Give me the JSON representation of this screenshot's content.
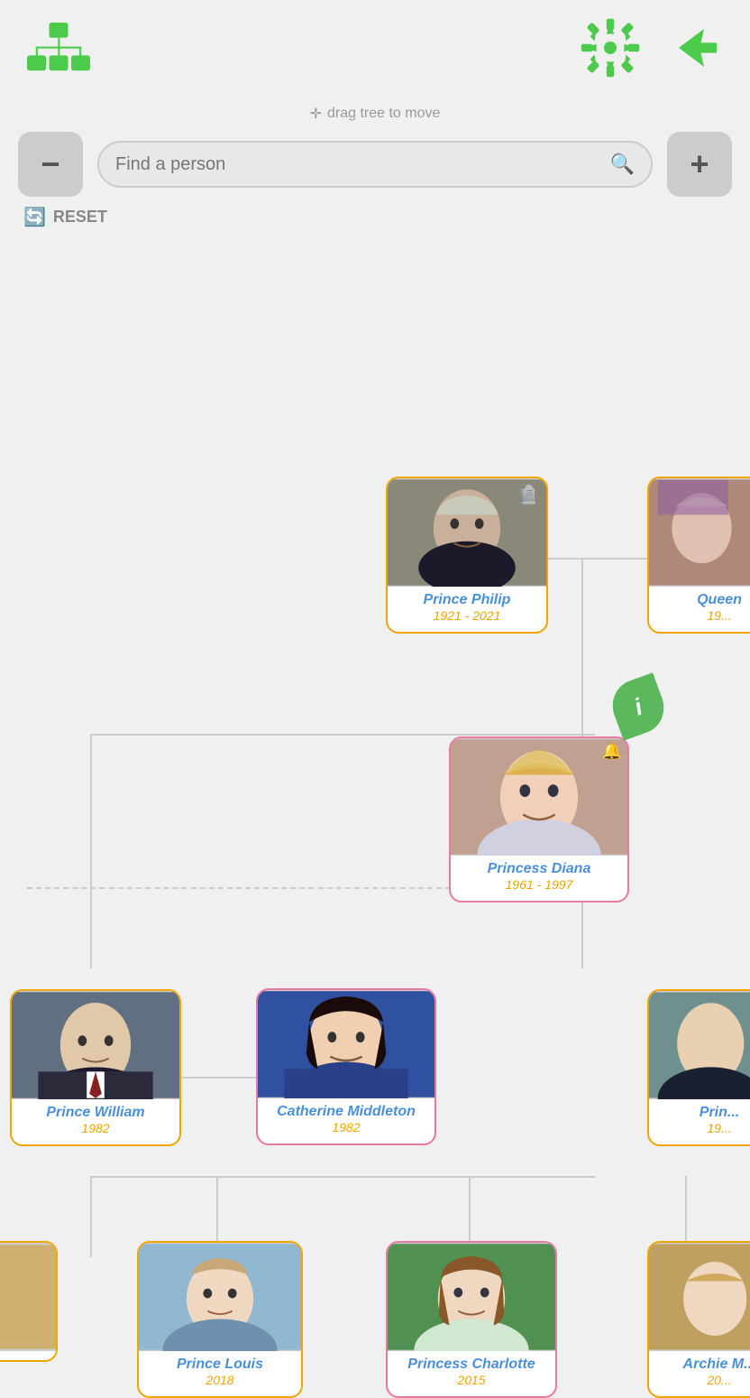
{
  "header": {
    "org_icon_label": "org-chart",
    "gear_icon_label": "settings",
    "share_icon_label": "share"
  },
  "toolbar": {
    "drag_hint": "drag tree to move",
    "search_placeholder": "Find a person",
    "zoom_out_label": "−",
    "zoom_in_label": "+",
    "reset_label": "RESET"
  },
  "persons": {
    "prince_philip": {
      "name": "Prince Philip",
      "years": "1921 - 2021",
      "deceased": true
    },
    "queen": {
      "name": "Queen",
      "years": "19...",
      "deceased": false
    },
    "princess_diana": {
      "name": "Princess Diana",
      "years": "1961 - 1997",
      "deceased": true
    },
    "prince_william": {
      "name": "Prince William",
      "years": "1982",
      "deceased": false
    },
    "catherine_middleton": {
      "name": "Catherine Middleton",
      "years": "1982",
      "deceased": false
    },
    "prince2": {
      "name": "Prin...",
      "years": "19...",
      "deceased": false
    },
    "prince_louis": {
      "name": "Prince Louis",
      "years": "2018",
      "deceased": false
    },
    "princess_charlotte": {
      "name": "Princess Charlotte",
      "years": "2015",
      "deceased": false
    },
    "archie": {
      "name": "Archie M...",
      "years": "20...",
      "deceased": false
    },
    "unknown_left": {
      "name": "...",
      "years": "",
      "deceased": false
    }
  }
}
